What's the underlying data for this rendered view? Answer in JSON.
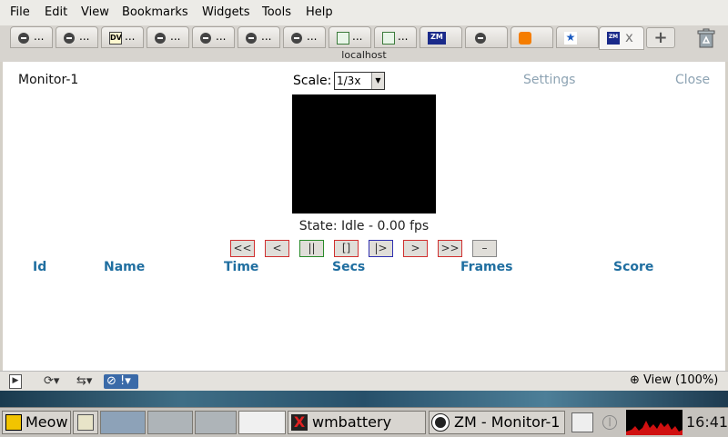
{
  "menu": [
    "File",
    "Edit",
    "View",
    "Bookmarks",
    "Widgets",
    "Tools",
    "Help"
  ],
  "tabs": {
    "ellipsis": "...",
    "active_close": "x",
    "new_tab": "+",
    "fav_zm": "ZM",
    "fav_dv": "DV"
  },
  "url_host": "localhost",
  "page": {
    "monitor_name": "Monitor-1",
    "scale_label": "Scale:",
    "scale_value": "1/3x",
    "settings": "Settings",
    "close": "Close",
    "state_text": "State: Idle - 0.00 fps",
    "controls": [
      "<<",
      "<",
      "||",
      "[]",
      "|>",
      ">",
      ">>",
      "–"
    ],
    "columns": [
      "Id",
      "Name",
      "Time",
      "Secs",
      "Frames",
      "Score"
    ]
  },
  "status": {
    "zoom": "View (100%)",
    "alert": "!"
  },
  "taskbar": {
    "meow": "Meow",
    "wmbattery": "wmbattery",
    "zm_window": "ZM - Monitor-1",
    "clock": "16:41"
  },
  "colors": {
    "header_blue": "#1f6ea0",
    "link_grey": "#8da3b3",
    "red_border": "#d03030",
    "green_border": "#2a8a2a",
    "blue_border": "#3030b0"
  }
}
